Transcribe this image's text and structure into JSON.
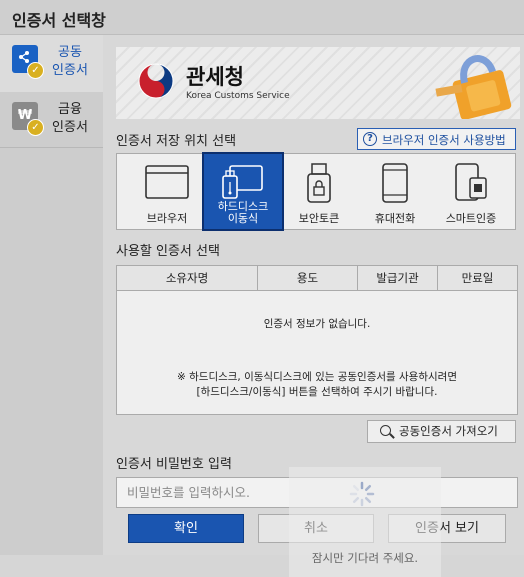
{
  "window": {
    "title": "인증서 선택창"
  },
  "sidebar": {
    "items": [
      {
        "label_line1": "공동",
        "label_line2": "인증서",
        "icon": "public-cert-icon",
        "active": true
      },
      {
        "label_line1": "금융",
        "label_line2": "인증서",
        "icon": "financial-cert-icon",
        "active": false
      }
    ]
  },
  "banner": {
    "org_name": "관세청",
    "org_name_en": "Korea Customs Service"
  },
  "storage": {
    "title": "인증서 저장 위치 선택",
    "help_label": "브라우저 인증서 사용방법",
    "locations": [
      {
        "label": "브라우저",
        "icon": "browser-icon",
        "selected": false
      },
      {
        "label_line1": "하드디스크",
        "label_line2": "이동식",
        "icon": "hard-disk-usb-icon",
        "selected": true
      },
      {
        "label": "보안토큰",
        "icon": "security-token-icon",
        "selected": false
      },
      {
        "label": "휴대전화",
        "icon": "mobile-phone-icon",
        "selected": false
      },
      {
        "label": "스마트인증",
        "icon": "smart-auth-icon",
        "selected": false
      }
    ]
  },
  "cert_table": {
    "title": "사용할 인증서 선택",
    "columns": [
      "소유자명",
      "용도",
      "발급기관",
      "만료일"
    ],
    "empty_message": "인증서 정보가 없습니다.",
    "note_line1": "※ 하드디스크, 이동식디스크에 있는 공동인증서를 사용하시려면",
    "note_line2": "[하드디스크/이동식] 버튼을 선택하여 주시기 바랍니다."
  },
  "import_button": {
    "label": "공동인증서 가져오기"
  },
  "password": {
    "title": "인증서 비밀번호 입력",
    "placeholder": "비밀번호를 입력하시오."
  },
  "buttons": {
    "ok": "확인",
    "cancel": "취소",
    "view": "인증서 보기"
  },
  "loading": {
    "message": "잠시만 기다려 주세요."
  },
  "colors": {
    "accent": "#1a55b0",
    "badge": "#d9b021"
  }
}
